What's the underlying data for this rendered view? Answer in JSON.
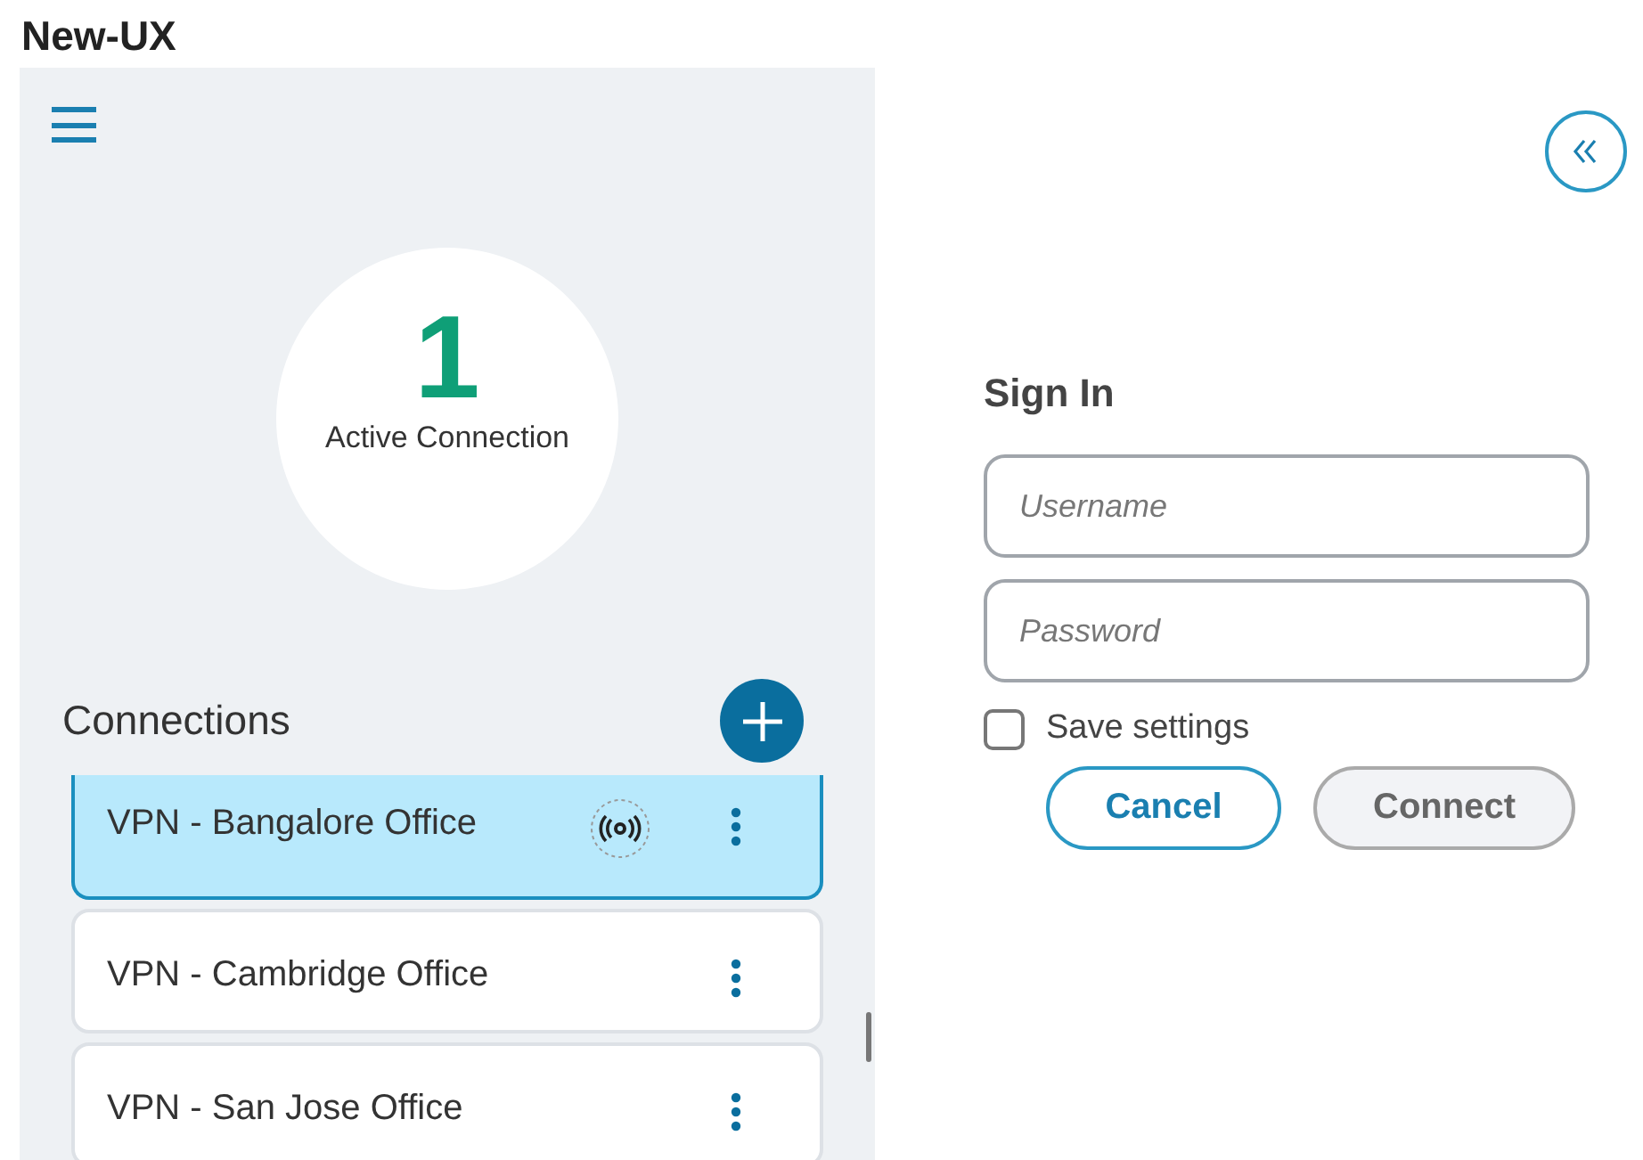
{
  "title": "New-UX",
  "summary": {
    "count": "1",
    "label": "Active Connection"
  },
  "connections": {
    "heading": "Connections",
    "items": [
      {
        "name": "VPN - Bangalore Office",
        "selected": true,
        "connected": true
      },
      {
        "name": "VPN - Cambridge Office",
        "selected": false,
        "connected": false
      },
      {
        "name": "VPN - San Jose Office",
        "selected": false,
        "connected": false
      }
    ]
  },
  "sign_in": {
    "heading": "Sign In",
    "username": {
      "placeholder": "Username"
    },
    "password": {
      "placeholder": "Password"
    },
    "save_settings": {
      "label": "Save settings",
      "checked": false
    },
    "buttons": [
      {
        "label": "Cancel",
        "kind": "secondary"
      },
      {
        "label": "Connect",
        "kind": "disabled"
      }
    ]
  }
}
